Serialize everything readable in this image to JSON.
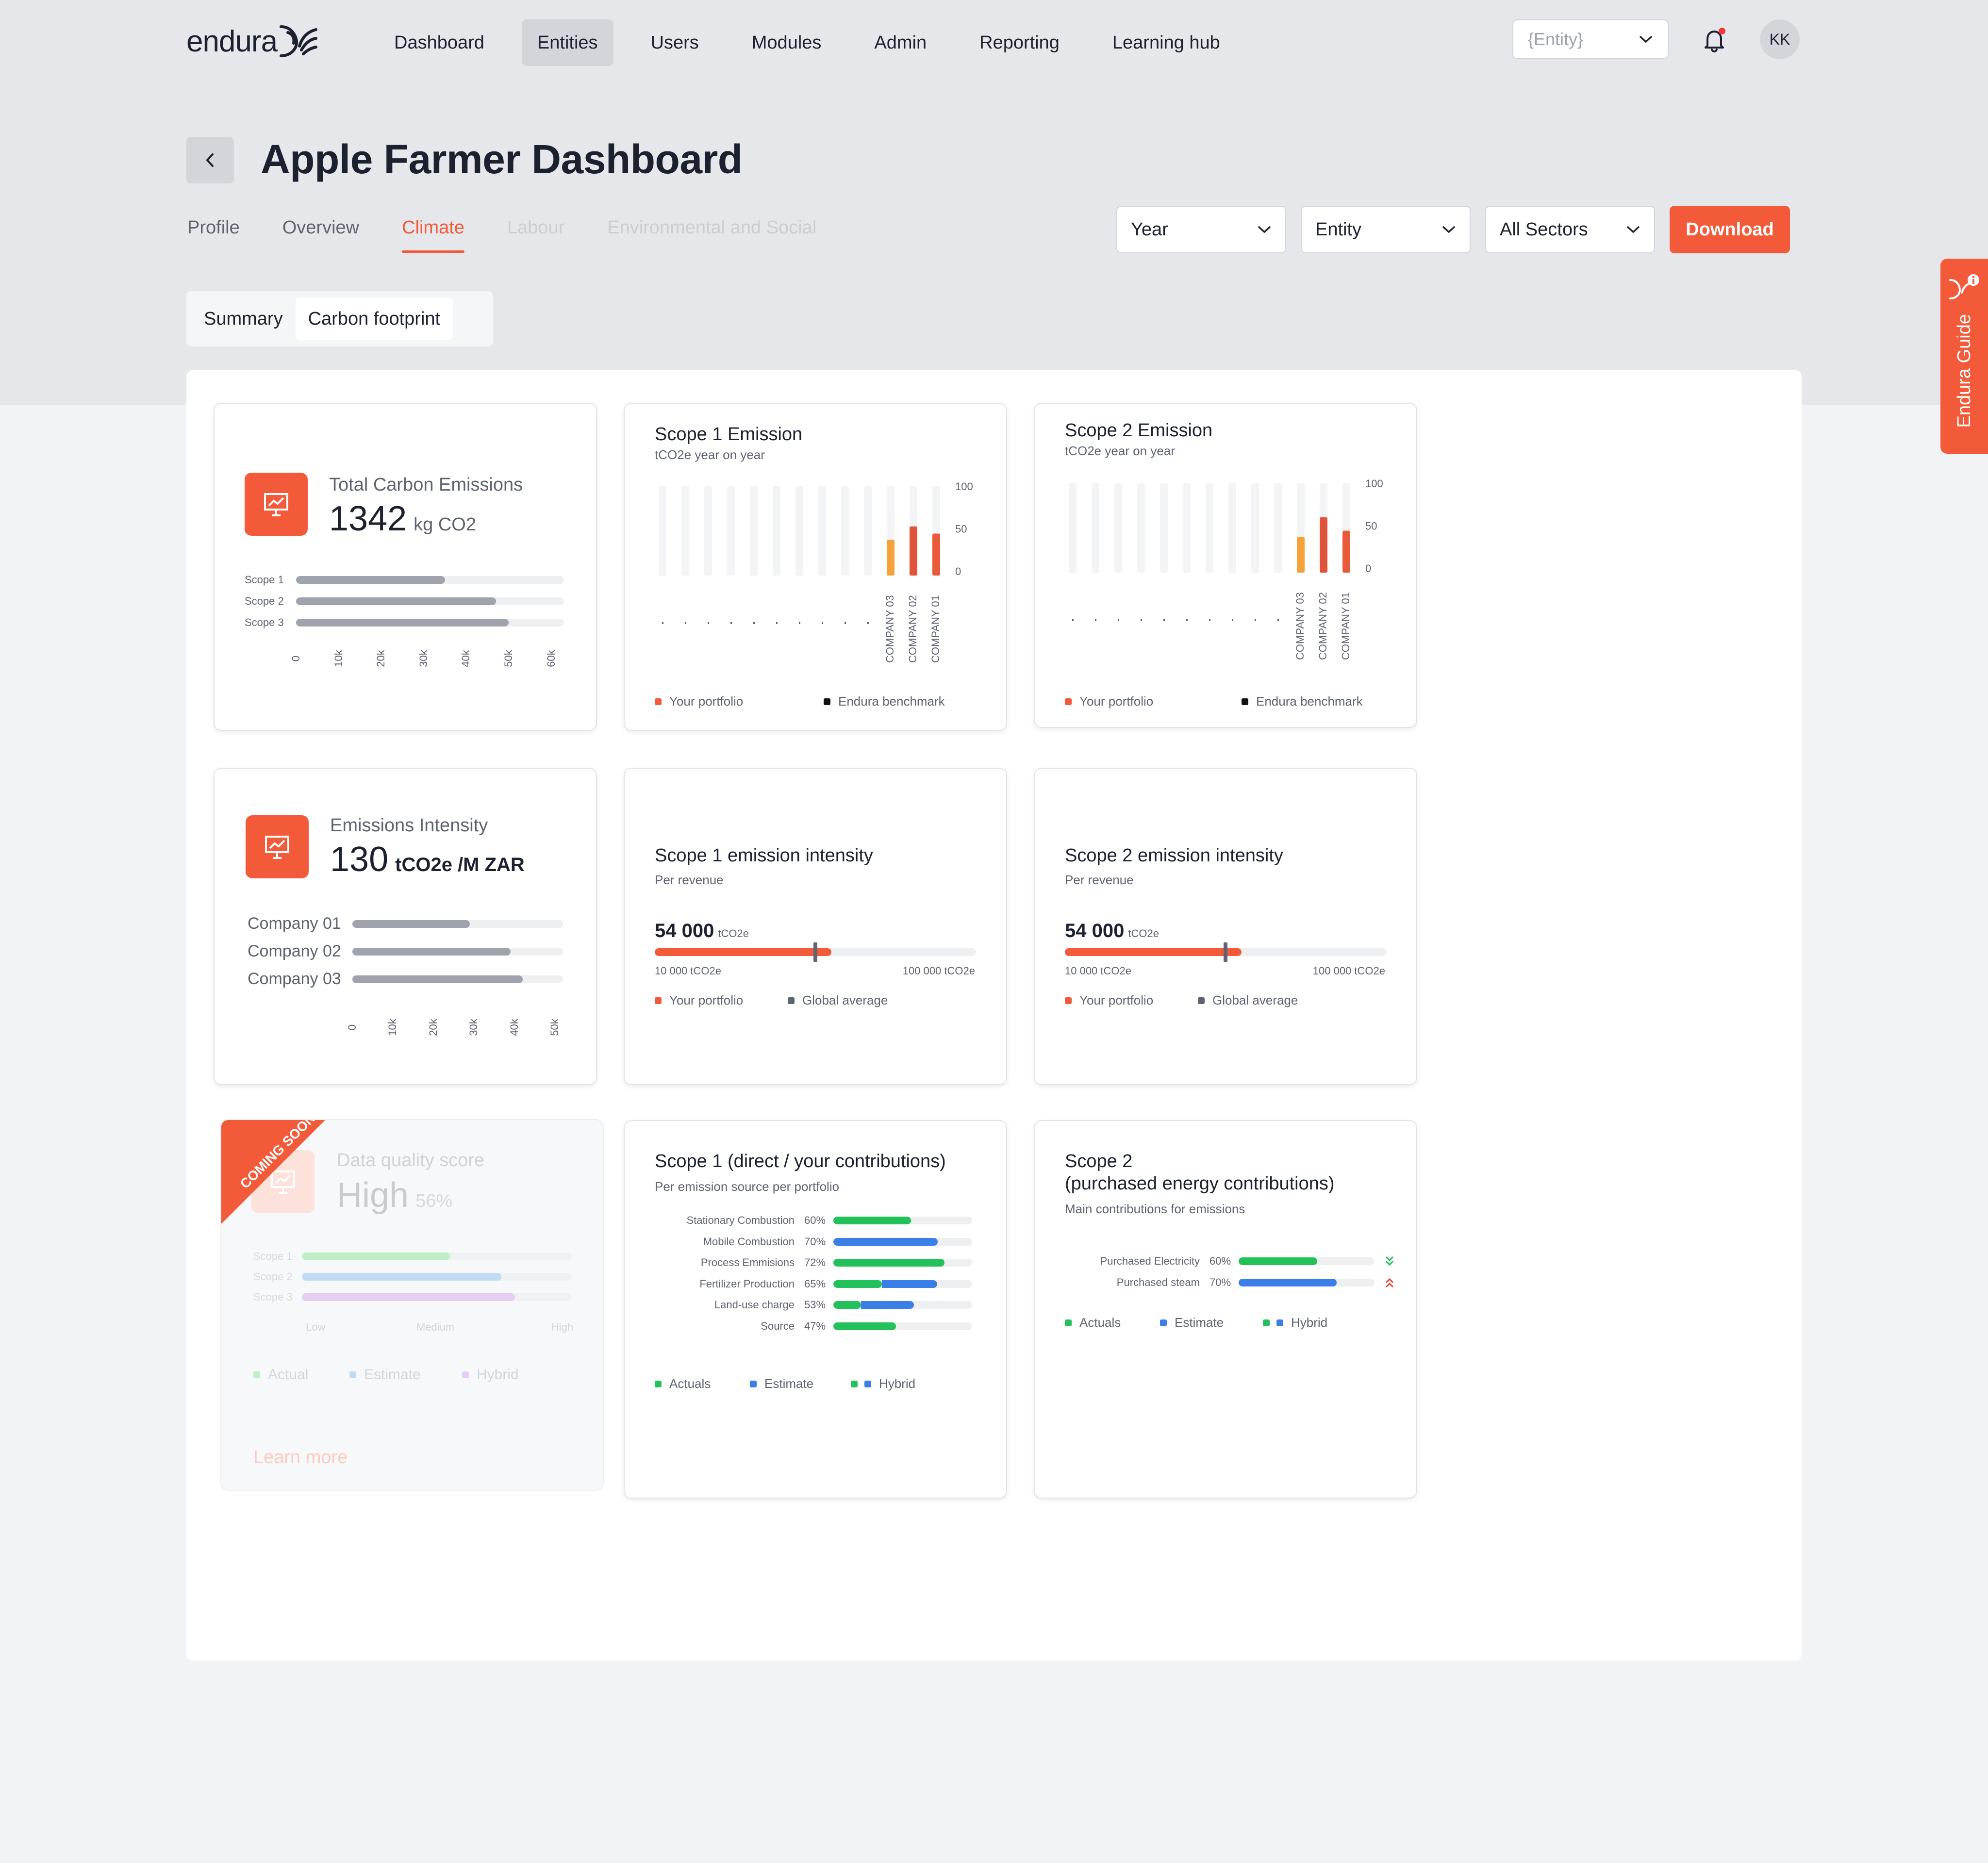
{
  "nav": {
    "brand": "endura",
    "items": [
      {
        "label": "Dashboard",
        "active": false
      },
      {
        "label": "Entities",
        "active": true
      },
      {
        "label": "Users",
        "active": false
      },
      {
        "label": "Modules",
        "active": false
      },
      {
        "label": "Admin",
        "active": false
      },
      {
        "label": "Reporting",
        "active": false
      },
      {
        "label": "Learning hub",
        "active": false
      }
    ],
    "entity_select": "{Entity}",
    "avatar": "KK",
    "notification_color": "#f23a3a"
  },
  "page": {
    "title": "Apple Farmer Dashboard",
    "tabs": [
      {
        "label": "Profile",
        "state": "normal"
      },
      {
        "label": "Overview",
        "state": "normal"
      },
      {
        "label": "Climate",
        "state": "active"
      },
      {
        "label": "Labour",
        "state": "disabled"
      },
      {
        "label": "Environmental and Social",
        "state": "disabled"
      }
    ],
    "filters": [
      "Year",
      "Entity",
      "All Sectors"
    ],
    "download": "Download",
    "subtabs": [
      {
        "label": "Summary",
        "active": false
      },
      {
        "label": "Carbon footprint",
        "active": true
      }
    ],
    "guide": "Endura Guide",
    "accent": "#f25a3a"
  },
  "total_emissions": {
    "label": "Total Carbon Emissions",
    "value": "1342",
    "unit": "kg CO2",
    "rows": [
      {
        "label": "Scope 1",
        "value": 35000
      },
      {
        "label": "Scope 2",
        "value": 47000
      },
      {
        "label": "Scope 3",
        "value": 50000
      }
    ],
    "ticks": [
      "0",
      "10k",
      "20k",
      "30k",
      "40k",
      "50k",
      "60k"
    ],
    "max": 63000
  },
  "scope1_emission": {
    "title": "Scope 1 Emission",
    "subtitle": "tCO2e year on year",
    "yticks": [
      "100",
      "50",
      "0"
    ],
    "companies": [
      "COMPANY 03",
      "COMPANY 02",
      "COMPANY 01"
    ],
    "legend": [
      "Your portfolio",
      "Endura benchmark"
    ]
  },
  "scope2_emission": {
    "title": "Scope 2 Emission",
    "subtitle": "tCO2e year on year",
    "yticks": [
      "100",
      "50",
      "0"
    ],
    "companies": [
      "COMPANY 03",
      "COMPANY 02",
      "COMPANY 01"
    ],
    "legend": [
      "Your portfolio",
      "Endura benchmark"
    ]
  },
  "chart_data": [
    {
      "type": "bar",
      "title": "Scope 1 Emission",
      "subtitle": "tCO2e year on year",
      "categories": [
        "",
        "",
        "",
        "",
        "",
        "",
        "",
        "",
        "",
        "",
        "COMPANY 03",
        "COMPANY 02",
        "COMPANY 01"
      ],
      "series": [
        {
          "name": "Your portfolio",
          "values": [
            0,
            0,
            0,
            0,
            0,
            0,
            0,
            0,
            0,
            0,
            40,
            55,
            47
          ]
        }
      ],
      "ylim": [
        0,
        100
      ],
      "colors": [
        "#f5a23a",
        "#e0533a",
        "#ea5a3a"
      ]
    },
    {
      "type": "bar",
      "title": "Scope 2 Emission",
      "subtitle": "tCO2e year on year",
      "categories": [
        "",
        "",
        "",
        "",
        "",
        "",
        "",
        "",
        "",
        "",
        "COMPANY 03",
        "COMPANY 02",
        "COMPANY 01"
      ],
      "series": [
        {
          "name": "Your portfolio",
          "values": [
            0,
            0,
            0,
            0,
            0,
            0,
            0,
            0,
            0,
            0,
            40,
            62,
            47
          ]
        }
      ],
      "ylim": [
        0,
        100
      ],
      "colors": [
        "#f5a23a",
        "#e0533a",
        "#ea5a3a"
      ]
    }
  ],
  "emissions_intensity": {
    "label": "Emissions Intensity",
    "value": "130",
    "unit": "tCO2e /M ZAR",
    "rows": [
      {
        "label": "Company 01",
        "value": 29000
      },
      {
        "label": "Company 02",
        "value": 39000
      },
      {
        "label": "Company 03",
        "value": 42000
      }
    ],
    "ticks": [
      "0",
      "10k",
      "20k",
      "30k",
      "40k",
      "50k"
    ],
    "max": 52000
  },
  "scope1_intensity": {
    "title": "Scope 1 emission intensity",
    "subtitle": "Per revenue",
    "value": "54 000",
    "unit": "tCO2e",
    "fill": 0.55,
    "marker": 0.5,
    "min": "10 000 tCO2e",
    "max": "100 000 tCO2e",
    "legend": [
      "Your portfolio",
      "Global average"
    ]
  },
  "scope2_intensity": {
    "title": "Scope 2 emission intensity",
    "subtitle": "Per revenue",
    "value": "54 000",
    "unit": "tCO2e",
    "fill": 0.55,
    "marker": 0.5,
    "min": "10 000 tCO2e",
    "max": "100 000 tCO2e",
    "legend": [
      "Your portfolio",
      "Global average"
    ]
  },
  "data_quality": {
    "ribbon": "COMING SOON",
    "label": "Data quality score",
    "value": "High",
    "pct": "56%",
    "rows": [
      {
        "label": "Scope 1",
        "value": 0.55,
        "color": "#bfefc9"
      },
      {
        "label": "Scope 2",
        "value": 0.74,
        "color": "#c3daf5"
      },
      {
        "label": "Scope 3",
        "value": 0.79,
        "color": "#e6cdf3"
      }
    ],
    "ticks": [
      "Low",
      "Medium",
      "High"
    ],
    "legend": [
      "Actual",
      "Estimate",
      "Hybrid"
    ],
    "link": "Learn more"
  },
  "scope1_contrib": {
    "title": "Scope 1 (direct / your contributions)",
    "subtitle": "Per emission source per portfolio",
    "rows": [
      {
        "label": "Stationary Combustion",
        "pct": "60%",
        "green": 0.56,
        "blue": 0
      },
      {
        "label": "Mobile Combustion",
        "pct": "70%",
        "green": 0,
        "blue": 0.75
      },
      {
        "label": "Process Emmisions",
        "pct": "72%",
        "green": 0.8,
        "blue": 0
      },
      {
        "label": "Fertilizer Production",
        "pct": "65%",
        "green": 0.35,
        "blue": 0.4
      },
      {
        "label": "Land-use charge",
        "pct": "53%",
        "green": 0.2,
        "blue": 0.38
      },
      {
        "label": "Source",
        "pct": "47%",
        "green": 0.45,
        "blue": 0
      }
    ],
    "legend": [
      "Actuals",
      "Estimate",
      "Hybrid"
    ]
  },
  "scope2_contrib": {
    "title": "Scope 2",
    "title2": "(purchased energy contributions)",
    "subtitle": "Main contributions for emissions",
    "rows": [
      {
        "label": "Purchased Electricity",
        "pct": "60%",
        "green": 0.58,
        "blue": 0,
        "trend": "down"
      },
      {
        "label": "Purchased steam",
        "pct": "70%",
        "green": 0,
        "blue": 0.72,
        "trend": "up"
      }
    ],
    "legend": [
      "Actuals",
      "Estimate",
      "Hybrid"
    ]
  }
}
